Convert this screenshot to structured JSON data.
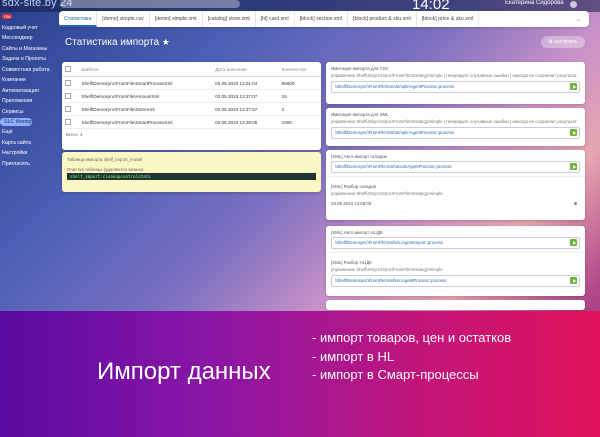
{
  "topbar": {
    "logo_main": "sdx-site.by",
    "logo_num": "24",
    "clock": "14:02",
    "user": "Екатерина Сидорова"
  },
  "sidebar": {
    "items": [
      {
        "label": "ОМ",
        "badge": ""
      },
      {
        "label": "Кадровый учет",
        "badge": ""
      },
      {
        "label": "Мессенджер",
        "badge": ""
      },
      {
        "label": "Сайты и Магазины",
        "badge": ""
      },
      {
        "label": "Задачи и Проекты",
        "badge": ""
      },
      {
        "label": "Совместная работа",
        "badge": ""
      },
      {
        "label": "Компания",
        "badge": ""
      },
      {
        "label": "Автоматизация",
        "badge": ""
      },
      {
        "label": "Приложения",
        "badge": ""
      },
      {
        "label": "Сервисы",
        "badge": ""
      },
      {
        "label": "SLC Импорт",
        "badge": ""
      },
      {
        "label": "Ещё",
        "badge": ""
      },
      {
        "label": "Карта сайта",
        "badge": ""
      },
      {
        "label": "Настройки",
        "badge": ""
      },
      {
        "label": "Пригласить",
        "badge": ""
      }
    ]
  },
  "tabs": [
    "Статистика",
    "[demo] simple.csv",
    "[demo] simple.xml",
    "[catalog] store.xml",
    "[hl] card.xml",
    "[block] section.xml",
    "[block] product & sku.xml",
    "[block] price & sku.xml"
  ],
  "page": {
    "title": "Статистика импорта",
    "settings_label": "настроить"
  },
  "table": {
    "headers": [
      "Шаблон",
      "Дата внесения",
      "Количество"
    ],
    "rows": [
      {
        "c1": "Shelf\\Demosync\\FromFile\\SmartProcessXml",
        "c2": "03.05.2023 13:01:04",
        "c3": "90000"
      },
      {
        "c1": "Shelf\\Demosync\\FromFile\\AmountXml",
        "c2": "03.05.2023 13:37:07",
        "c3": "15"
      },
      {
        "c1": "Shelf\\Demosync\\FromFile\\StoreXml",
        "c2": "03.05.2023 13:37:57",
        "c3": "2"
      },
      {
        "c1": "Shelf\\Demosync\\FromFile\\SmartProcessXml",
        "c2": "03.05.2023 13:38:06",
        "c3": "1000"
      }
    ],
    "footer": "Всего: 4"
  },
  "yellow": {
    "line1": "Таблица импорта shelf_import_model",
    "line2": "Очистка таблицы (удаляются записи)",
    "code": "shelf_import:cleanupcontrolstats"
  },
  "cards": [
    {
      "title": "Имитация импорта для CSV",
      "desc": "управление Shelf\\InSync\\Sync\\FromFile\\Strategy\\Simple | генерирует случайные ошибки | никогда не сохраняет результат",
      "field": "\\Shelf\\Demosync\\FromFile\\Csv\\Simple\\AgentProcess::process"
    },
    {
      "title": "Имитация импорта для XML",
      "desc": "управление Shelf\\InSync\\Sync\\FromFile\\Strategy\\Simple | генерирует случайные ошибки | никогда не сохраняет результат",
      "field": "\\Shelf\\Demosync\\FromFile\\Xml\\Simple\\AgentProcess::process"
    },
    {
      "title": "[XML] Авто импорт складов",
      "field": "\\Shelf\\Demosync\\FromFile\\Xml\\Stock\\AgentProcess::process",
      "title2": "[XML] Разбор складов",
      "desc2": "управление Shelf\\InSync\\Sync\\FromFile\\Strategy\\Simple",
      "date": "03.05.2023 13:58:09"
    },
    {
      "title": "[XML] Авто импорт HL/ДК",
      "field": "\\Shelf\\Demosync\\FromFile\\Xml\\HL\\AgentImport::process",
      "title2": "[XML] Разбор HL/ДК",
      "desc2": "управление Shelf\\InSync\\Sync\\FromFile\\Strategy\\Simple",
      "field2": "\\Shelf\\Demosync\\FromFile\\Xml\\HL\\AgentProcess::process"
    }
  ],
  "banner": {
    "title": "Импорт данных",
    "items": [
      "- импорт товаров, цен и остатков",
      "- импорт в HL",
      "- импорт в Смарт-процессы"
    ]
  }
}
